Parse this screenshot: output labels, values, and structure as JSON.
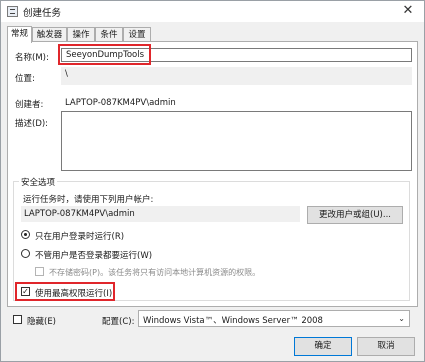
{
  "window": {
    "title": "创建任务",
    "close_glyph": "✕"
  },
  "tabs": [
    {
      "label": "常规"
    },
    {
      "label": "触发器"
    },
    {
      "label": "操作"
    },
    {
      "label": "条件"
    },
    {
      "label": "设置"
    }
  ],
  "general": {
    "name_label": "名称(M):",
    "name_value": "SeeyonDumpTools",
    "location_label": "位置:",
    "location_value": "\\",
    "author_label": "创建者:",
    "author_value": "LAPTOP-087KM4PV\\admin",
    "description_label": "描述(D):",
    "description_value": ""
  },
  "security": {
    "group_label": "安全选项",
    "run_as_label": "运行任务时，请使用下列用户帐户:",
    "account_value": "LAPTOP-087KM4PV\\admin",
    "change_button": "更改用户或组(U)...",
    "radio_logged_on": "只在用户登录时运行(R)",
    "radio_whether": "不管用户是否登录都要运行(W)",
    "no_store_password": "不存储密码(P)。该任务将只有访问本地计算机资源的权限。",
    "highest_privileges": "使用最高权限运行(I)"
  },
  "footer": {
    "hidden_label": "隐藏(E)",
    "configure_label": "配置(C):",
    "configure_value": "Windows Vista™、Windows Server™ 2008",
    "ok_button": "确定",
    "cancel_button": "取消"
  },
  "colors": {
    "highlight_border": "#e0262b",
    "dialog_bg": "#f0f0f0"
  }
}
